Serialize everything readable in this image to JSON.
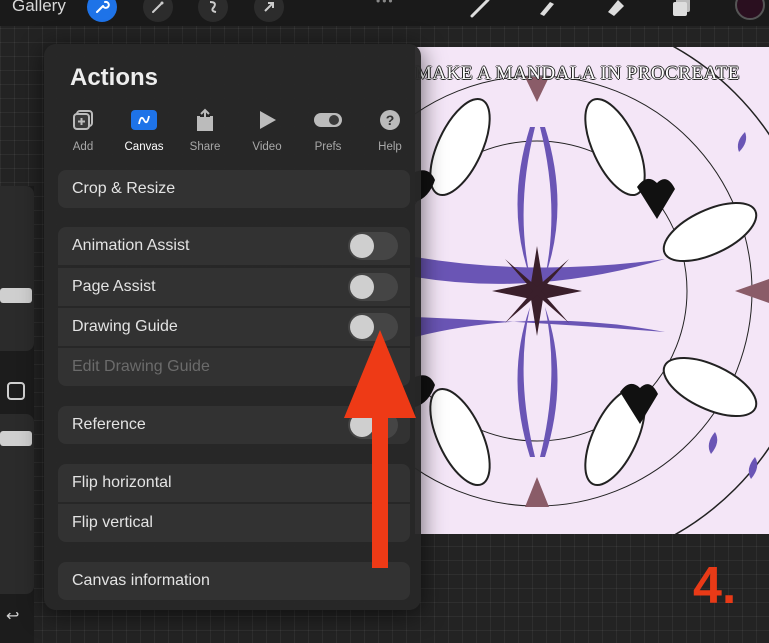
{
  "toolbar": {
    "gallery_label": "Gallery",
    "left_icons": [
      "wrench-icon",
      "magic-wand-icon",
      "selection-icon",
      "transform-arrow-icon"
    ],
    "right_icons": [
      "brush-icon",
      "smudge-icon",
      "eraser-icon",
      "layers-icon"
    ],
    "color": "#2a0f1f",
    "accent": "#1e73e8"
  },
  "actions": {
    "title": "Actions",
    "tabs": [
      {
        "label": "Add",
        "icon": "add-image-icon"
      },
      {
        "label": "Canvas",
        "icon": "canvas-icon",
        "active": true
      },
      {
        "label": "Share",
        "icon": "share-icon"
      },
      {
        "label": "Video",
        "icon": "play-icon"
      },
      {
        "label": "Prefs",
        "icon": "toggle-icon"
      },
      {
        "label": "Help",
        "icon": "help-icon"
      }
    ],
    "items": {
      "crop_resize": "Crop & Resize",
      "animation_assist": "Animation Assist",
      "page_assist": "Page Assist",
      "drawing_guide": "Drawing Guide",
      "edit_drawing_guide": "Edit Drawing Guide",
      "reference": "Reference",
      "flip_horizontal": "Flip horizontal",
      "flip_vertical": "Flip vertical",
      "canvas_information": "Canvas information"
    },
    "toggles": {
      "animation_assist": false,
      "page_assist": false,
      "drawing_guide": false,
      "reference": false
    }
  },
  "canvas": {
    "title": "MAKE A MANDALA IN PROCREATE",
    "background": "#f4e6f7"
  },
  "annotation": {
    "step": "4.",
    "color": "#e93a17"
  }
}
